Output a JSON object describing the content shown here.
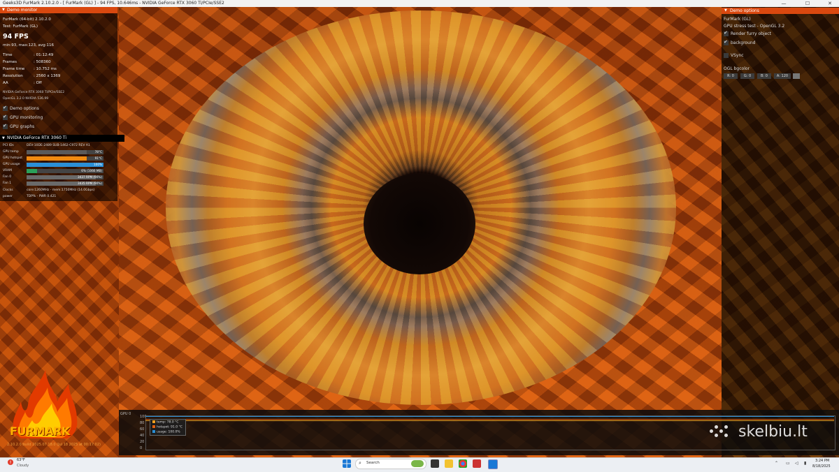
{
  "window": {
    "title": "Geeks3D FurMark 2.10.2.0 - [ FurMark (GL) ] - 94 FPS, 10.646ms - NVIDIA GeForce RTX 3060 Ti/PCIe/SSE2",
    "min": "—",
    "max": "☐",
    "close": "✕"
  },
  "monitor": {
    "header": "Demo monitor",
    "app": "FurMark (64-bit) 2.10.2.0",
    "test": "Test: FurMark (GL)",
    "fps": "94 FPS",
    "minmax": "min:93, max:123, avg:116",
    "stats": [
      {
        "k": "Time",
        "v": ": 01:12:49"
      },
      {
        "k": "Frames",
        "v": ": 508360"
      },
      {
        "k": "Frame time",
        "v": ": 10.752 ms"
      },
      {
        "k": "Resolution",
        "v": ": 2560 x 1369"
      },
      {
        "k": "AA",
        "v": ": Off"
      }
    ],
    "gpu_name": "NVIDIA GeForce RTX 3060 Ti/PCIe/SSE2",
    "opengl": "OpenGL 3.2.0 NVIDIA 536.99",
    "options": [
      "Demo options",
      "GPU monitoring",
      "GPU graphs"
    ]
  },
  "gpu": {
    "header": "NVIDIA GeForce RTX 3060 Ti",
    "pci": "PCI IDs",
    "pci_value": "DEV-10DE-2489 SUB-1462-C972 REV A1",
    "rows": [
      {
        "label": "GPU temp",
        "text": "78°C",
        "fill": 0.78,
        "color": "#5a5a5a"
      },
      {
        "label": "GPU hotspot",
        "text": "91°C",
        "fill": 0.78,
        "color": "#f08a10"
      },
      {
        "label": "GPU usage",
        "text": "100%",
        "fill": 1.0,
        "color": "#2b8fd6"
      },
      {
        "label": "VRAM",
        "text": "6% (1066 MB)",
        "fill": 0.14,
        "color": "#2aa05a"
      },
      {
        "label": "Fan 0",
        "text": "3437 RPM (90%)",
        "fill": 0.9,
        "color": "#6a6a6a"
      },
      {
        "label": "Fan 1",
        "text": "3435 RPM (90%)",
        "fill": 0.9,
        "color": "#6a6a6a"
      }
    ],
    "clocks_label": "Clocks",
    "clocks_value": "core:1260MHz - mem:1750MHz (14.0Gbps)",
    "power_label": "power",
    "power_value": "TDP% - PWR 0.421"
  },
  "options": {
    "header": "Demo options",
    "demo": "FurMark (GL)",
    "desc": "GPU stress test - OpenGL 3.2",
    "render_furry": "Render furry object",
    "background": "background",
    "vsync": "VSync",
    "bgcolor_label": "OGL bgcolor",
    "r": "R: 0",
    "g": "G: 0",
    "b": "B: 0",
    "a": "A: 120"
  },
  "graph": {
    "label": "GPU 0",
    "yticks": [
      "100",
      "80",
      "60",
      "40",
      "20",
      "0"
    ],
    "legend": [
      {
        "name": "temp: 78.0 °C",
        "color": "#f0a020"
      },
      {
        "name": "hotspot: 91.0 °C",
        "color": "#e06010"
      },
      {
        "name": "usage: 100.0%",
        "color": "#2b8fd6"
      }
    ]
  },
  "logo": {
    "text": "FURMARK",
    "version": "2.10.2.0 build 2025.07.18.0 (Jul 18 2025 at 00:17:02)"
  },
  "watermark": "skelbiu.lt",
  "taskbar": {
    "weather_temp": "63°F",
    "weather_desc": "Cloudy",
    "search": "Search",
    "time": "3:24 PM",
    "date": "8/18/2025"
  },
  "colors": {
    "accent": "#d9480f",
    "panel": "#000000"
  }
}
